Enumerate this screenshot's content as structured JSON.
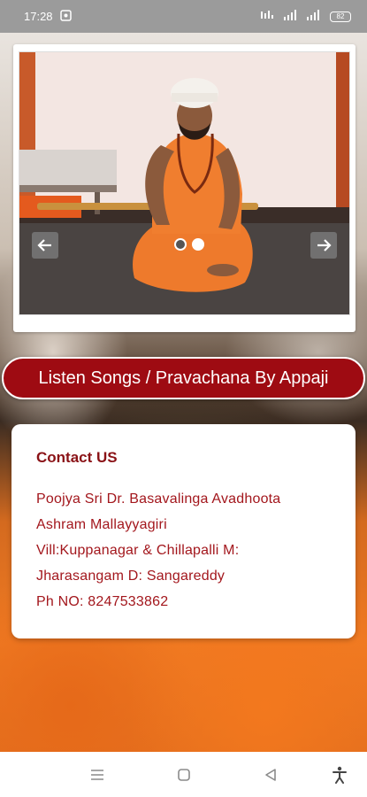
{
  "status_bar": {
    "time": "17:28",
    "battery": "82"
  },
  "slider": {
    "slide_count": 2,
    "active_slide": 2
  },
  "listen_button": {
    "label": "Listen Songs / Pravachana By Appaji"
  },
  "contact": {
    "title": "Contact US",
    "lines": [
      "Poojya Sri Dr. Basavalinga Avadhoota",
      "Ashram Mallayyagiri",
      "Vill:Kuppanagar & Chillapalli M:",
      "Jharasangam D: Sangareddy",
      "Ph NO: 8247533862"
    ]
  },
  "colors": {
    "accent": "#9e0b12",
    "text_dark_red": "#8a1216",
    "status_bar": "#9b9b9b"
  },
  "icons": {
    "nav": [
      "menu-icon",
      "home-icon",
      "back-icon",
      "accessibility-icon"
    ]
  }
}
